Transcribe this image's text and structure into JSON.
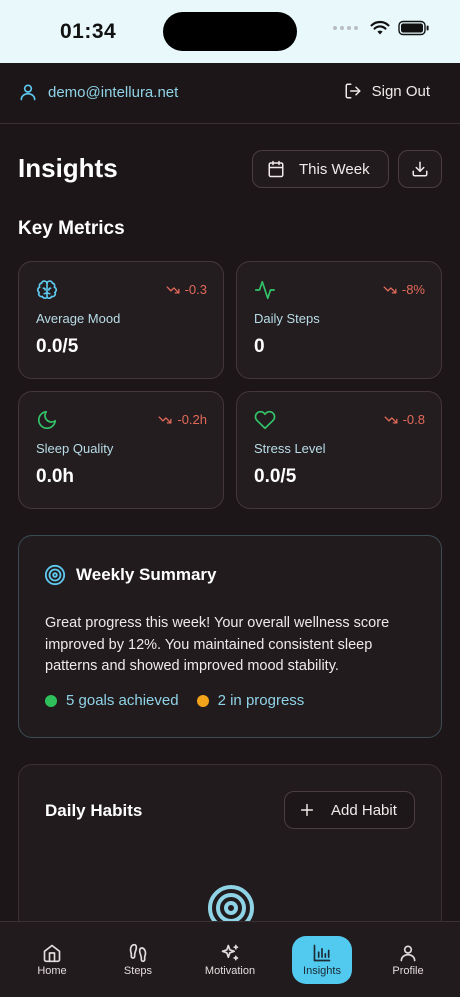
{
  "status_bar": {
    "time": "01:34"
  },
  "header": {
    "user_email": "demo@intellura.net",
    "sign_out_label": "Sign Out"
  },
  "page": {
    "title": "Insights",
    "period_label": "This Week"
  },
  "key_metrics": {
    "title": "Key Metrics",
    "items": [
      {
        "label": "Average Mood",
        "value": "0.0/5",
        "change": "-0.3",
        "icon": "brain-icon",
        "icon_color": "#5ec9ee"
      },
      {
        "label": "Daily Steps",
        "value": "0",
        "change": "-8%",
        "icon": "activity-icon",
        "icon_color": "#33c46a"
      },
      {
        "label": "Sleep Quality",
        "value": "0.0h",
        "change": "-0.2h",
        "icon": "moon-icon",
        "icon_color": "#33c46a"
      },
      {
        "label": "Stress Level",
        "value": "0.0/5",
        "change": "-0.8",
        "icon": "heart-icon",
        "icon_color": "#33c46a"
      }
    ],
    "negative_color": "#e26a5a"
  },
  "weekly_summary": {
    "title": "Weekly Summary",
    "text": "Great progress this week! Your overall wellness score improved by 12%. You maintained consistent sleep patterns and showed improved mood stability.",
    "stats": [
      {
        "label": "5 goals achieved",
        "color": "#2fbf5b"
      },
      {
        "label": "2 in progress",
        "color": "#f2a31c"
      }
    ]
  },
  "daily_habits": {
    "title": "Daily Habits",
    "add_label": "Add Habit"
  },
  "nav": {
    "items": [
      {
        "label": "Home",
        "icon": "home-icon"
      },
      {
        "label": "Steps",
        "icon": "footprints-icon"
      },
      {
        "label": "Motivation",
        "icon": "sparkles-icon"
      },
      {
        "label": "Insights",
        "icon": "bar-chart-icon",
        "active": true
      },
      {
        "label": "Profile",
        "icon": "user-icon"
      }
    ],
    "accent": "#52c9ef"
  }
}
